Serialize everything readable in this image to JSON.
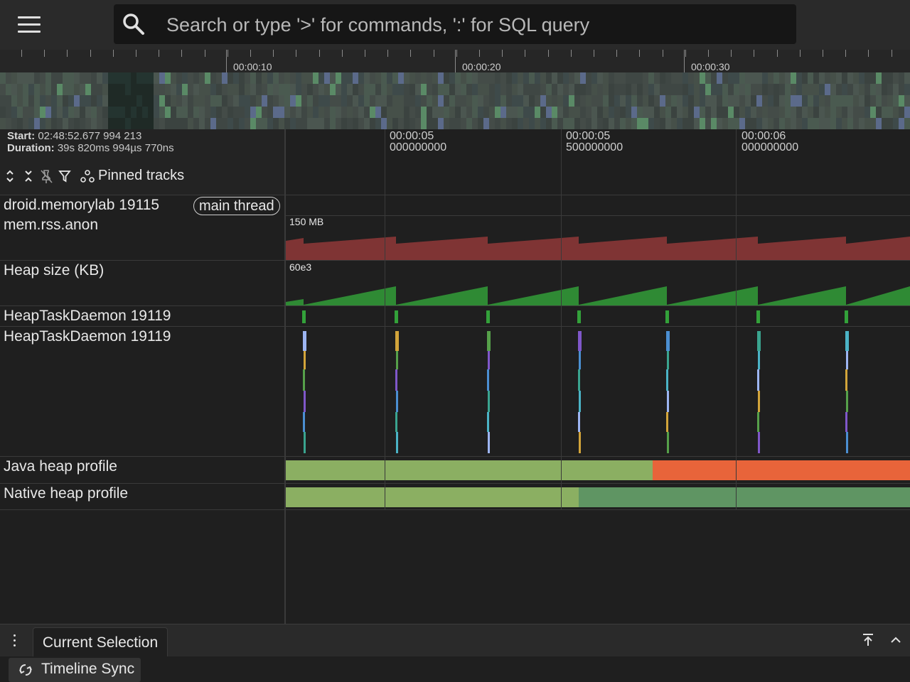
{
  "search": {
    "placeholder": "Search or type '>' for commands, ':' for SQL query"
  },
  "icons": {
    "menu": "hamburger-menu-icon",
    "search": "search-icon",
    "expand": "expand-all-icon",
    "collapse": "collapse-all-icon",
    "unpin": "unpin-icon",
    "filter": "filter-icon",
    "pinned": "pinned-tracks-icon",
    "sync": "sync-icon"
  },
  "overview": {
    "ticks": [
      "00:00:10",
      "00:00:20",
      "00:00:30"
    ]
  },
  "info": {
    "start_label": "Start:",
    "start_value": "02:48:52.677 994 213",
    "duration_label": "Duration:",
    "duration_value": "39s 820ms 994µs 770ns"
  },
  "toolbar": {
    "pinned_tracks_label": "Pinned tracks"
  },
  "time_header": [
    {
      "top": "00:00:05",
      "bottom": "000000000"
    },
    {
      "top": "00:00:05",
      "bottom": "500000000"
    },
    {
      "top": "00:00:06",
      "bottom": "000000000"
    }
  ],
  "tracks": {
    "process": {
      "label": "droid.memorylab 19115",
      "chip": "main thread"
    },
    "rss": {
      "label": "mem.rss.anon",
      "max": "150 MB",
      "color": "#7f3434"
    },
    "heap": {
      "label": "Heap size (KB)",
      "max": "60e3",
      "color": "#2f8a34"
    },
    "heaptask1": {
      "label": "HeapTaskDaemon 19119",
      "color": "#33a13a"
    },
    "heaptask2": {
      "label": "HeapTaskDaemon 19119"
    },
    "java": {
      "label": "Java heap profile",
      "color_a": "#8baf62",
      "color_b": "#e8643a"
    },
    "native": {
      "label": "Native heap profile",
      "color_a": "#8baf62",
      "color_b": "#5f9563"
    }
  },
  "bottom": {
    "tab_label": "Current Selection",
    "sync_label": "Timeline Sync"
  }
}
